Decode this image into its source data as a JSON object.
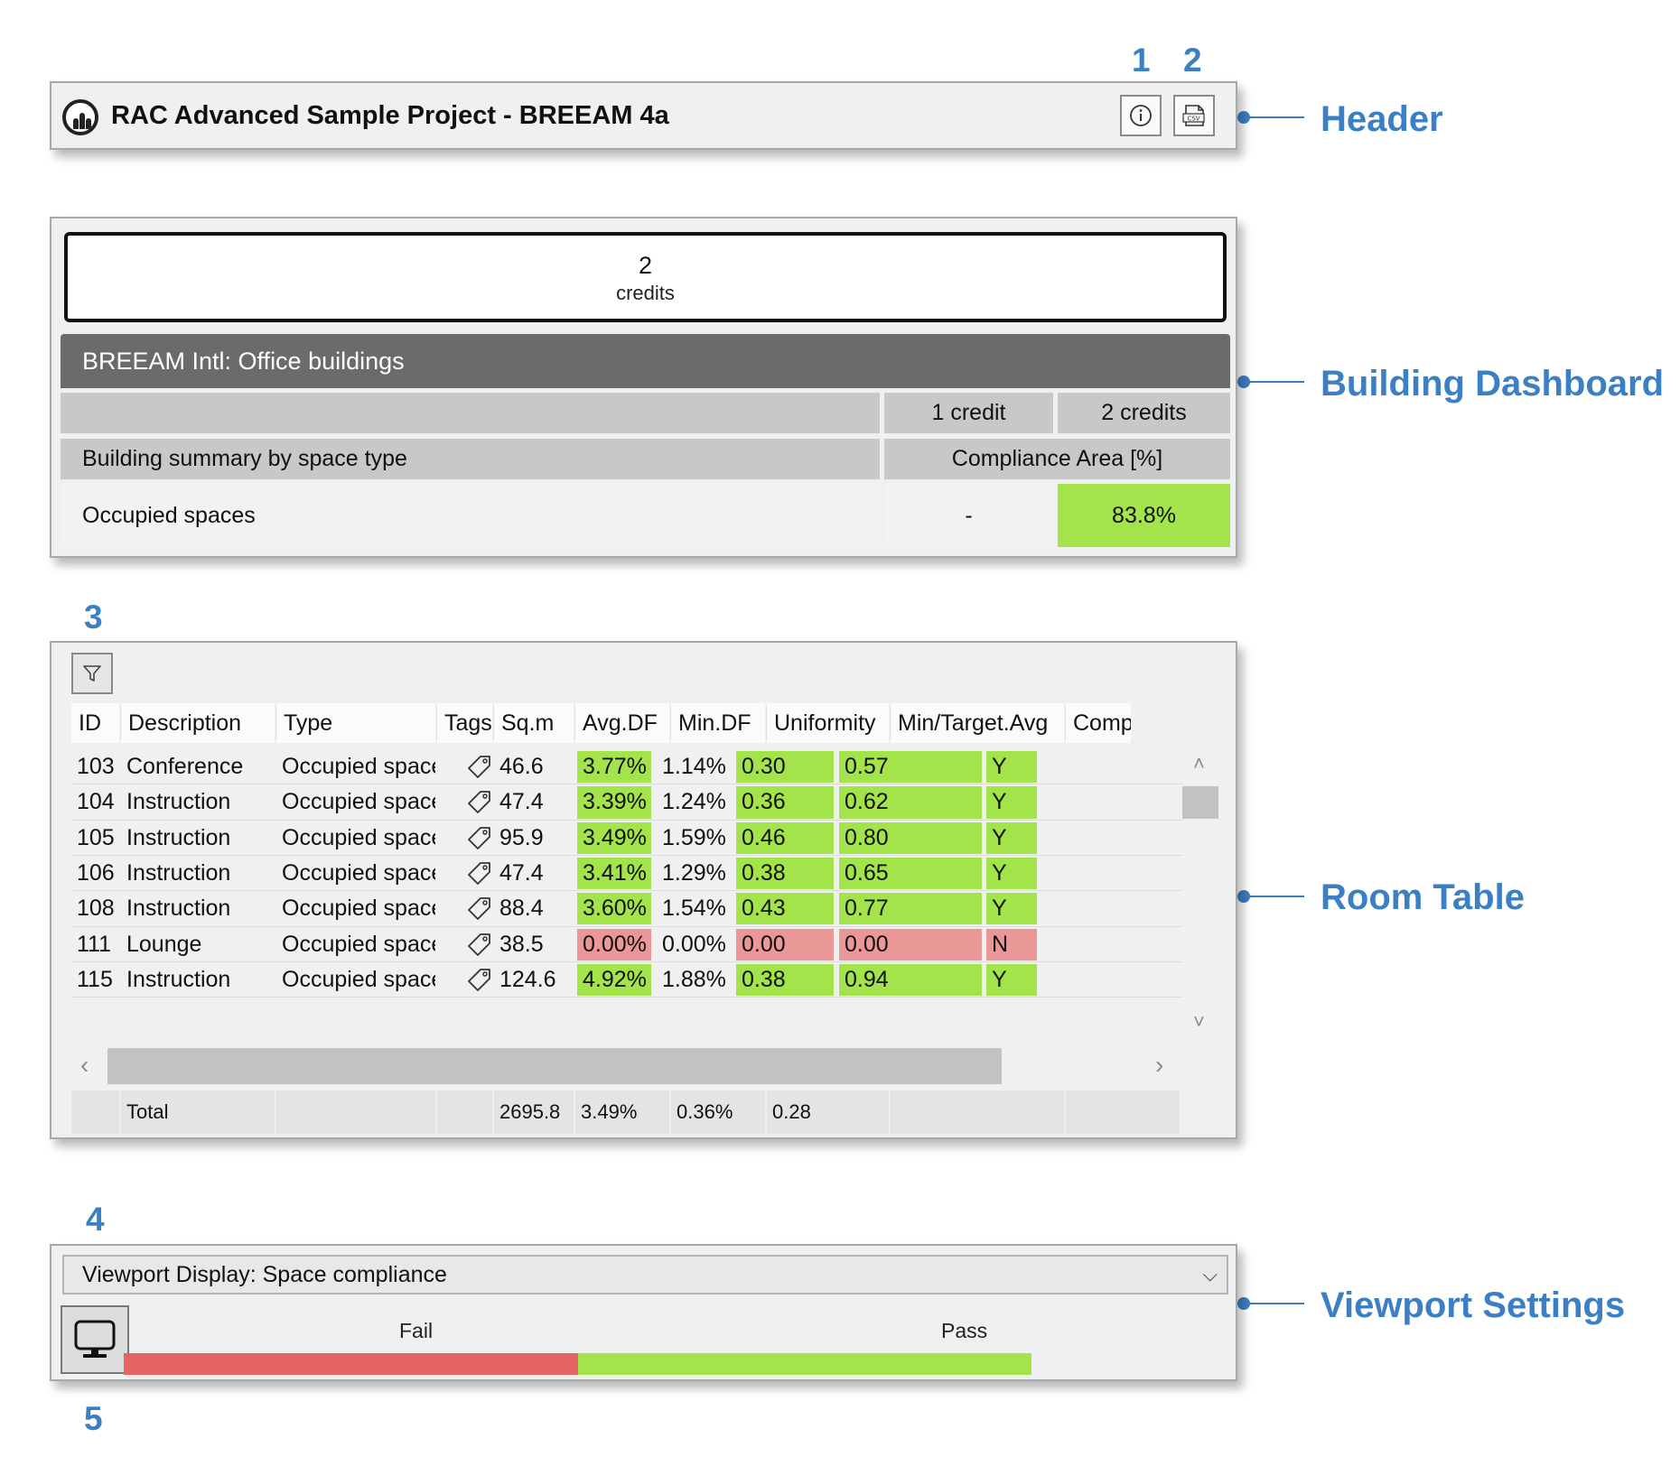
{
  "callouts": {
    "n1": "1",
    "n2": "2",
    "n3": "3",
    "n4": "4",
    "n5": "5"
  },
  "section_labels": {
    "header": "Header",
    "dashboard": "Building Dashboard",
    "room_table": "Room Table",
    "viewport": "Viewport Settings"
  },
  "header": {
    "title": "RAC Advanced Sample Project - BREEAM 4a",
    "info_icon": "info-icon",
    "csv_icon": "csv-export-icon"
  },
  "dashboard": {
    "credits_value": "2",
    "credits_label": "credits",
    "category": "BREEAM Intl: Office buildings",
    "col_1credit": "1 credit",
    "col_2credits": "2 credits",
    "summary_label": "Building summary by space type",
    "compliance_header": "Compliance Area [%]",
    "row_label": "Occupied spaces",
    "row_1credit": "-",
    "row_2credits": "83.8%"
  },
  "room_table": {
    "filter_icon": "filter-icon",
    "columns": [
      "ID",
      "Description",
      "Type",
      "Tags",
      "Sq.m",
      "Avg.DF",
      "Min.DF",
      "Uniformity",
      "Min/Target.Avg",
      "Comp"
    ],
    "rows": [
      {
        "id": "103",
        "description": "Conference",
        "type": "Occupied spaces",
        "sqm": "46.6",
        "avg_df": "3.77%",
        "min_df": "1.14%",
        "uniformity": "0.30",
        "min_target": "0.57",
        "comp": "Y"
      },
      {
        "id": "104",
        "description": "Instruction",
        "type": "Occupied spaces",
        "sqm": "47.4",
        "avg_df": "3.39%",
        "min_df": "1.24%",
        "uniformity": "0.36",
        "min_target": "0.62",
        "comp": "Y"
      },
      {
        "id": "105",
        "description": "Instruction",
        "type": "Occupied spaces",
        "sqm": "95.9",
        "avg_df": "3.49%",
        "min_df": "1.59%",
        "uniformity": "0.46",
        "min_target": "0.80",
        "comp": "Y"
      },
      {
        "id": "106",
        "description": "Instruction",
        "type": "Occupied spaces",
        "sqm": "47.4",
        "avg_df": "3.41%",
        "min_df": "1.29%",
        "uniformity": "0.38",
        "min_target": "0.65",
        "comp": "Y"
      },
      {
        "id": "108",
        "description": "Instruction",
        "type": "Occupied spaces",
        "sqm": "88.4",
        "avg_df": "3.60%",
        "min_df": "1.54%",
        "uniformity": "0.43",
        "min_target": "0.77",
        "comp": "Y"
      },
      {
        "id": "111",
        "description": "Lounge",
        "type": "Occupied spaces",
        "sqm": "38.5",
        "avg_df": "0.00%",
        "min_df": "0.00%",
        "uniformity": "0.00",
        "min_target": "0.00",
        "comp": "N"
      },
      {
        "id": "115",
        "description": "Instruction",
        "type": "Occupied spaces",
        "sqm": "124.6",
        "avg_df": "4.92%",
        "min_df": "1.88%",
        "uniformity": "0.38",
        "min_target": "0.94",
        "comp": "Y"
      }
    ],
    "totals": {
      "label": "Total",
      "sqm": "2695.8",
      "avg_df": "3.49%",
      "min_df": "0.36%",
      "uniformity": "0.28"
    }
  },
  "viewport": {
    "display_select": "Viewport Display: Space compliance",
    "legend_fail": "Fail",
    "legend_pass": "Pass",
    "fail_fraction": 0.5,
    "display_icon": "monitor-icon"
  },
  "colors": {
    "accent": "#3b7fc4",
    "pass": "#a3e44a",
    "fail": "#e99797",
    "legend_fail": "#e46464",
    "legend_pass": "#a3e44a",
    "category_bg": "#6b6b6b"
  }
}
